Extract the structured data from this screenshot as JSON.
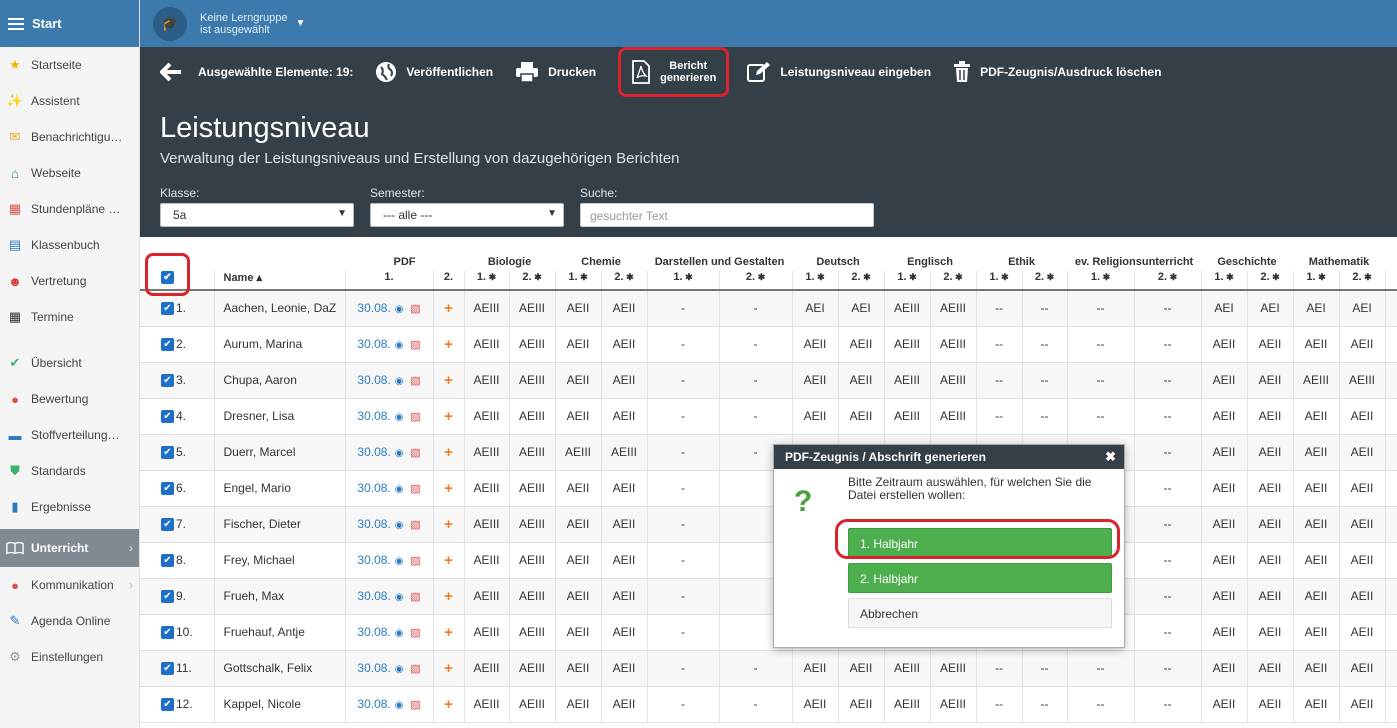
{
  "sidebar": {
    "header": "Start",
    "items": [
      {
        "label": "Startseite",
        "icon": "star-icon",
        "glyph": "★",
        "color": "#f0b400"
      },
      {
        "label": "Assistent",
        "icon": "wand-icon",
        "glyph": "✨",
        "color": "#d33"
      },
      {
        "label": "Benachrichtigu…",
        "icon": "envelope-icon",
        "glyph": "✉",
        "color": "#f0a020"
      },
      {
        "label": "Webseite",
        "icon": "home-icon",
        "glyph": "⌂",
        "color": "#2a9a4a"
      },
      {
        "label": "Stundenpläne …",
        "icon": "timetable-icon",
        "glyph": "▦",
        "color": "#d9534f"
      },
      {
        "label": "Klassenbuch",
        "icon": "book-icon",
        "glyph": "▤",
        "color": "#2a7bc0"
      },
      {
        "label": "Vertretung",
        "icon": "person-icon",
        "glyph": "☻",
        "color": "#d33"
      },
      {
        "label": "Termine",
        "icon": "calendar-icon",
        "glyph": "▦",
        "color": "#333"
      }
    ],
    "items2": [
      {
        "label": "Übersicht",
        "icon": "check-circle-icon",
        "glyph": "✔",
        "color": "#3cb371"
      },
      {
        "label": "Bewertung",
        "icon": "rating-icon",
        "glyph": "●",
        "color": "#d9534f"
      },
      {
        "label": "Stoffverteilung…",
        "icon": "briefcase-icon",
        "glyph": "▬",
        "color": "#2a7bc0"
      },
      {
        "label": "Standards",
        "icon": "shield-icon",
        "glyph": "⛊",
        "color": "#3cb371"
      },
      {
        "label": "Ergebnisse",
        "icon": "bar-chart-icon",
        "glyph": "▮",
        "color": "#2a7bc0"
      }
    ],
    "active": "Unterricht",
    "items3": [
      {
        "label": "Kommunikation",
        "icon": "chat-icon",
        "glyph": "●",
        "color": "#d9534f",
        "chev": true
      },
      {
        "label": "Agenda Online",
        "icon": "pen-icon",
        "glyph": "✎",
        "color": "#2a7bc0",
        "chev": false
      },
      {
        "label": "Einstellungen",
        "icon": "gear-icon",
        "glyph": "⚙",
        "color": "#999",
        "chev": false
      }
    ]
  },
  "topbar": {
    "group_line1": "Keine Lerngruppe",
    "group_line2": "ist ausgewählt"
  },
  "toolbar": {
    "selected": "Ausgewählte Elemente: 19:",
    "publish": "Veröffentlichen",
    "print": "Drucken",
    "report_line1": "Bericht",
    "report_line2": "generieren",
    "enter_level": "Leistungsniveau eingeben",
    "delete_pdf": "PDF-Zeugnis/Ausdruck löschen"
  },
  "page": {
    "title": "Leistungsniveau",
    "subtitle": "Verwaltung der Leistungsniveaus und Erstellung von dazugehörigen Berichten"
  },
  "filters": {
    "class_label": "Klasse:",
    "class_value": "5a",
    "semester_label": "Semester:",
    "semester_value": "--- alle ---",
    "search_label": "Suche:",
    "search_placeholder": "gesuchter Text"
  },
  "table": {
    "header_name": "Name ▴",
    "header_pdf": "PDF",
    "subjects": [
      "Biologie",
      "Chemie",
      "Darstellen und Gestalten",
      "Deutsch",
      "Englisch",
      "Ethik",
      "ev. Religionsunterricht",
      "Geschichte",
      "Mathematik"
    ],
    "pdf_sub": [
      "1.",
      "2."
    ],
    "sub_label_1": "1.",
    "sub_label_2": "2.",
    "rows": [
      {
        "nr": "1.",
        "name": "Aachen, Leonie, DaZ",
        "date": "30.08.",
        "grades": [
          "AEIII",
          "AEIII",
          "AEII",
          "AEII",
          "-",
          "-",
          "AEI",
          "AEI",
          "AEIII",
          "AEIII",
          "--",
          "--",
          "--",
          "--",
          "AEI",
          "AEI",
          "AEI",
          "AEI"
        ]
      },
      {
        "nr": "2.",
        "name": "Aurum, Marina",
        "date": "30.08.",
        "grades": [
          "AEIII",
          "AEIII",
          "AEII",
          "AEII",
          "-",
          "-",
          "AEII",
          "AEII",
          "AEIII",
          "AEIII",
          "--",
          "--",
          "--",
          "--",
          "AEII",
          "AEII",
          "AEII",
          "AEII"
        ]
      },
      {
        "nr": "3.",
        "name": "Chupa, Aaron",
        "date": "30.08.",
        "grades": [
          "AEIII",
          "AEIII",
          "AEII",
          "AEII",
          "-",
          "-",
          "AEII",
          "AEII",
          "AEIII",
          "AEIII",
          "--",
          "--",
          "--",
          "--",
          "AEII",
          "AEII",
          "AEIII",
          "AEIII"
        ]
      },
      {
        "nr": "4.",
        "name": "Dresner, Lisa",
        "date": "30.08.",
        "grades": [
          "AEIII",
          "AEIII",
          "AEII",
          "AEII",
          "-",
          "-",
          "AEII",
          "AEII",
          "AEIII",
          "AEIII",
          "--",
          "--",
          "--",
          "--",
          "AEII",
          "AEII",
          "AEII",
          "AEII"
        ]
      },
      {
        "nr": "5.",
        "name": "Duerr, Marcel",
        "date": "30.08.",
        "grades": [
          "AEIII",
          "AEIII",
          "AEIII",
          "AEIII",
          "-",
          "-",
          "",
          "",
          "",
          "",
          "",
          "",
          "",
          "--",
          "AEII",
          "AEII",
          "AEII",
          "AEII"
        ]
      },
      {
        "nr": "6.",
        "name": "Engel, Mario",
        "date": "30.08.",
        "grades": [
          "AEIII",
          "AEIII",
          "AEII",
          "AEII",
          "-",
          "",
          "",
          "",
          "",
          "",
          "",
          "",
          "",
          "--",
          "AEII",
          "AEII",
          "AEII",
          "AEII"
        ]
      },
      {
        "nr": "7.",
        "name": "Fischer, Dieter",
        "date": "30.08.",
        "grades": [
          "AEIII",
          "AEIII",
          "AEII",
          "AEII",
          "-",
          "",
          "",
          "",
          "",
          "",
          "",
          "",
          "",
          "--",
          "AEII",
          "AEII",
          "AEII",
          "AEII"
        ]
      },
      {
        "nr": "8.",
        "name": "Frey, Michael",
        "date": "30.08.",
        "grades": [
          "AEIII",
          "AEIII",
          "AEII",
          "AEII",
          "-",
          "",
          "",
          "",
          "",
          "",
          "",
          "",
          "",
          "--",
          "AEII",
          "AEII",
          "AEII",
          "AEII"
        ]
      },
      {
        "nr": "9.",
        "name": "Frueh, Max",
        "date": "30.08.",
        "grades": [
          "AEIII",
          "AEIII",
          "AEII",
          "AEII",
          "-",
          "",
          "",
          "",
          "",
          "",
          "",
          "",
          "",
          "--",
          "AEII",
          "AEII",
          "AEII",
          "AEII"
        ]
      },
      {
        "nr": "10.",
        "name": "Fruehauf, Antje",
        "date": "30.08.",
        "grades": [
          "AEIII",
          "AEIII",
          "AEII",
          "AEII",
          "-",
          "",
          "",
          "",
          "",
          "",
          "",
          "",
          "",
          "--",
          "AEII",
          "AEII",
          "AEII",
          "AEII"
        ]
      },
      {
        "nr": "11.",
        "name": "Gottschalk, Felix",
        "date": "30.08.",
        "grades": [
          "AEIII",
          "AEIII",
          "AEII",
          "AEII",
          "-",
          "-",
          "AEII",
          "AEII",
          "AEIII",
          "AEIII",
          "--",
          "--",
          "--",
          "--",
          "AEII",
          "AEII",
          "AEII",
          "AEII"
        ]
      },
      {
        "nr": "12.",
        "name": "Kappel, Nicole",
        "date": "30.08.",
        "grades": [
          "AEIII",
          "AEIII",
          "AEII",
          "AEII",
          "-",
          "-",
          "AEII",
          "AEII",
          "AEIII",
          "AEIII",
          "--",
          "--",
          "--",
          "--",
          "AEII",
          "AEII",
          "AEII",
          "AEII"
        ]
      }
    ]
  },
  "modal": {
    "title": "PDF-Zeugnis / Abschrift generieren",
    "question": "?",
    "text": "Bitte Zeitraum auswählen, für welchen Sie die Datei erstellen wollen:",
    "option1": "1. Halbjahr",
    "option2": "2. Halbjahr",
    "cancel": "Abbrechen"
  }
}
